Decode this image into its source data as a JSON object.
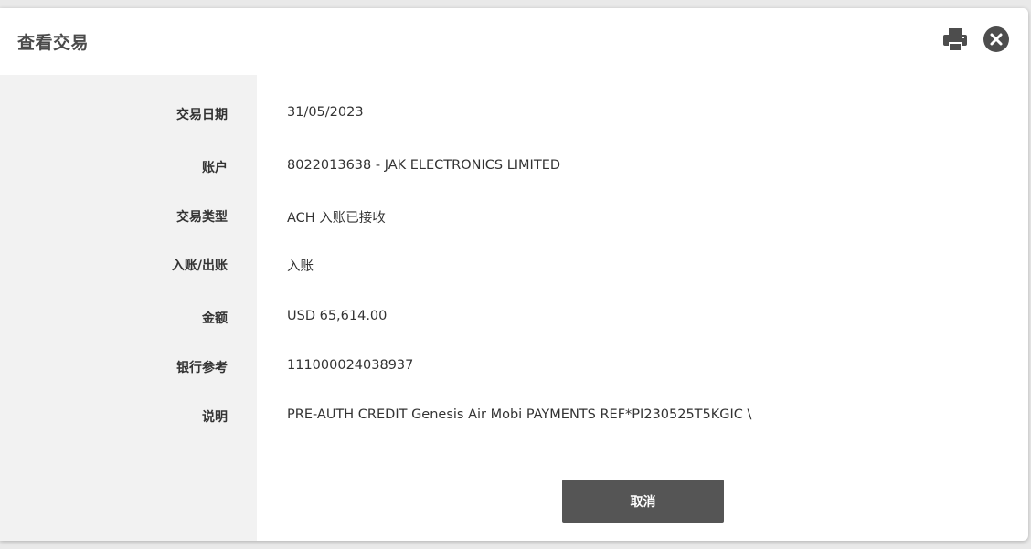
{
  "dialog": {
    "title": "查看交易",
    "print_icon": "print-icon",
    "close_icon": "close-icon"
  },
  "fields": [
    {
      "label": "交易日期",
      "value": "31/05/2023"
    },
    {
      "label": "账户",
      "value": "8022013638 - JAK ELECTRONICS LIMITED"
    },
    {
      "label": "交易类型",
      "value": "ACH 入账已接收"
    },
    {
      "label": "入账/出账",
      "value": "入账"
    },
    {
      "label": "金额",
      "value": "USD 65,614.00"
    },
    {
      "label": "银行参考",
      "value": "111000024038937"
    },
    {
      "label": "说明",
      "value": "PRE-AUTH CREDIT Genesis Air Mobi PAYMENTS REF*PI230525T5KGIC \\"
    }
  ],
  "actions": {
    "cancel_label": "取消"
  },
  "colors": {
    "label_column_bg": "#f2f2f2",
    "button_bg": "#555555",
    "icon": "#4d4d4d"
  }
}
